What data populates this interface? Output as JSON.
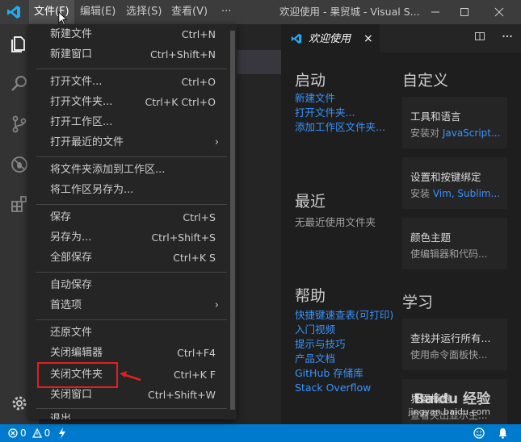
{
  "titlebar": {
    "menus": [
      "文件(F)",
      "编辑(E)",
      "选择(S)",
      "查看(V)",
      "···"
    ],
    "title": "欢迎使用 - 果贸城 - Visual S..."
  },
  "file_menu": {
    "groups": [
      [
        {
          "label": "新建文件",
          "shortcut": "Ctrl+N"
        },
        {
          "label": "新建窗口",
          "shortcut": "Ctrl+Shift+N"
        }
      ],
      [
        {
          "label": "打开文件...",
          "shortcut": "Ctrl+O"
        },
        {
          "label": "打开文件夹...",
          "shortcut": "Ctrl+K Ctrl+O"
        },
        {
          "label": "打开工作区...",
          "shortcut": ""
        },
        {
          "label": "打开最近的文件",
          "shortcut": "",
          "submenu": true
        }
      ],
      [
        {
          "label": "将文件夹添加到工作区...",
          "shortcut": ""
        },
        {
          "label": "将工作区另存为...",
          "shortcut": ""
        }
      ],
      [
        {
          "label": "保存",
          "shortcut": "Ctrl+S"
        },
        {
          "label": "另存为...",
          "shortcut": "Ctrl+Shift+S"
        },
        {
          "label": "全部保存",
          "shortcut": "Ctrl+K S"
        }
      ],
      [
        {
          "label": "自动保存",
          "shortcut": ""
        },
        {
          "label": "首选项",
          "shortcut": "",
          "submenu": true
        }
      ],
      [
        {
          "label": "还原文件",
          "shortcut": ""
        },
        {
          "label": "关闭编辑器",
          "shortcut": "Ctrl+F4"
        },
        {
          "label": "关闭文件夹",
          "shortcut": "Ctrl+K F",
          "highlighted": true
        },
        {
          "label": "关闭窗口",
          "shortcut": "Ctrl+Shift+W"
        }
      ]
    ],
    "partial_bottom_item": "退出"
  },
  "editor": {
    "tab_label": "欢迎使用",
    "tab_close": "×",
    "start": {
      "heading": "启动",
      "links": [
        "新建文件",
        "打开文件夹...",
        "添加工作区文件夹..."
      ]
    },
    "recent": {
      "heading": "最近",
      "empty_text": "无最近使用文件夹"
    },
    "help": {
      "heading": "帮助",
      "links": [
        "快捷键速查表(可打印)",
        "入门视频",
        "提示与技巧",
        "产品文档",
        "GitHub 存储库",
        "Stack Overflow"
      ]
    },
    "customize": {
      "heading": "自定义",
      "cards": [
        {
          "title": "工具和语言",
          "desc_prefix": "安装对 ",
          "desc_link": "JavaScript..."
        },
        {
          "title": "设置和按键绑定",
          "desc_prefix": "安装 ",
          "desc_link": "Vim, Sublim..."
        },
        {
          "title": "颜色主题",
          "desc_prefix": "使编辑器和代码...",
          "desc_link": ""
        }
      ]
    },
    "learn": {
      "heading": "学习",
      "cards": [
        {
          "title": "查找并运行所有...",
          "desc": "使用命令面板快..."
        },
        {
          "title": "界面概览",
          "desc": "查看突出显示主..."
        }
      ]
    }
  },
  "statusbar": {
    "errors": "0",
    "warnings": "0"
  },
  "watermark": {
    "text": "Baidu 经验",
    "url": "jingyan.baidu.com"
  },
  "colors": {
    "accent": "#007acc",
    "link": "#3794ff",
    "highlight_box": "#e02020"
  }
}
